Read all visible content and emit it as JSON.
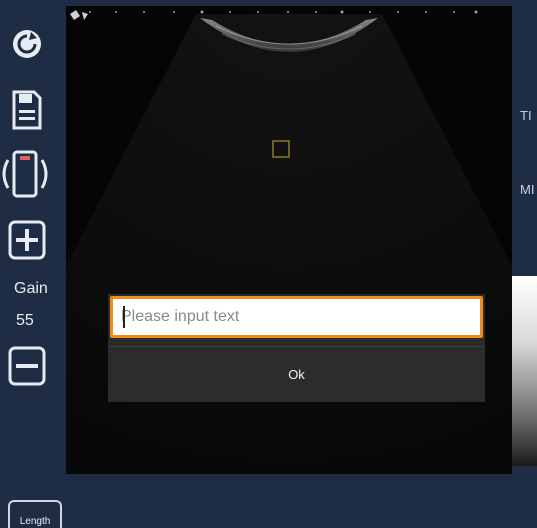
{
  "toolbar": {
    "items": [
      {
        "name": "refresh",
        "icon": "refresh-icon"
      },
      {
        "name": "save",
        "icon": "save-icon"
      },
      {
        "name": "rotate-probe",
        "icon": "rotate-icon"
      },
      {
        "name": "gain-increase",
        "icon": "plus-icon"
      },
      {
        "name": "gain-decrease",
        "icon": "minus-icon"
      }
    ],
    "gain_label": "Gain",
    "gain_value": "55"
  },
  "right_panel": {
    "ti_label": "TI",
    "mi_label": "MI"
  },
  "bottom": {
    "length_label": "Length"
  },
  "dialog": {
    "input_value": "",
    "input_placeholder": "Please input text",
    "ok_label": "Ok"
  },
  "colors": {
    "background": "#1f2d44",
    "scan_background": "#050505",
    "dialog_background": "#2a2a2a",
    "input_focus_border": "#f08c1e",
    "focus_box": "#8a7a1e"
  }
}
